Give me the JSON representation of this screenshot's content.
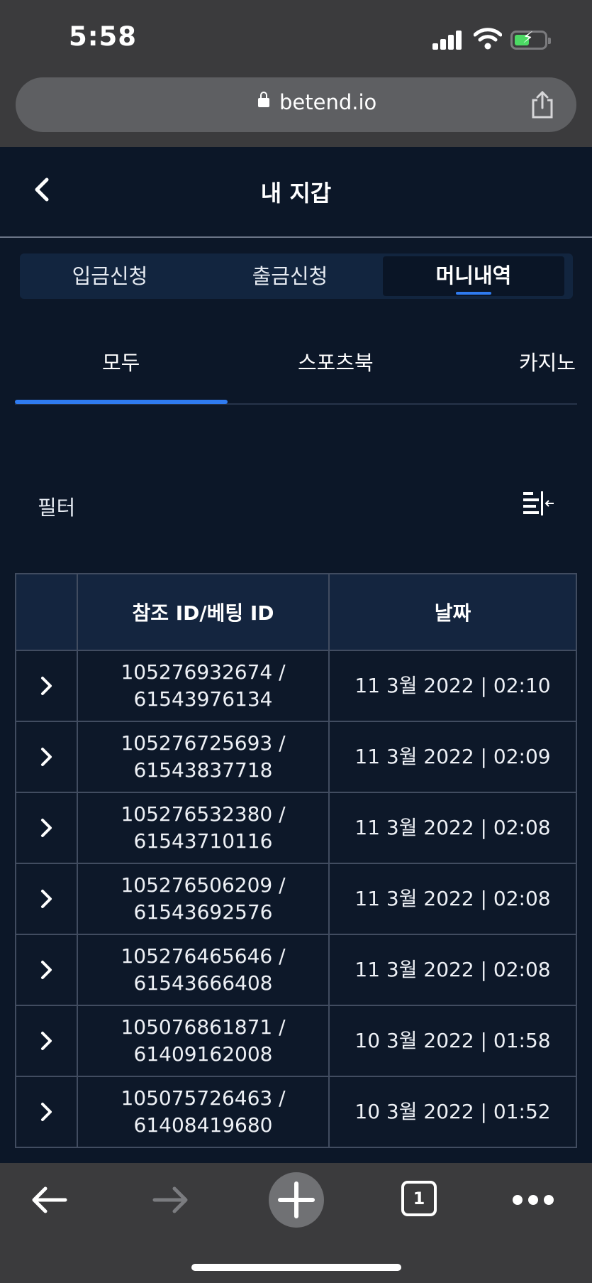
{
  "status_bar": {
    "time": "5:58"
  },
  "browser": {
    "url": "betend.io",
    "tab_count": "1"
  },
  "header": {
    "title": "내 지갑"
  },
  "segmented_tabs": [
    {
      "label": "입금신청",
      "active": false
    },
    {
      "label": "출금신청",
      "active": false
    },
    {
      "label": "머니내역",
      "active": true
    }
  ],
  "category_tabs": [
    {
      "label": "모두",
      "active": true
    },
    {
      "label": "스포츠북",
      "active": false
    },
    {
      "label": "카지노",
      "active": false
    }
  ],
  "filter": {
    "label": "필터"
  },
  "table": {
    "columns": [
      "",
      "참조 ID/베팅 ID",
      "날짜"
    ],
    "rows": [
      {
        "id_line1": "105276932674 /",
        "id_line2": "61543976134",
        "date": "11 3월 2022 | 02:10"
      },
      {
        "id_line1": "105276725693 /",
        "id_line2": "61543837718",
        "date": "11 3월 2022 | 02:09"
      },
      {
        "id_line1": "105276532380 /",
        "id_line2": "61543710116",
        "date": "11 3월 2022 | 02:08"
      },
      {
        "id_line1": "105276506209 /",
        "id_line2": "61543692576",
        "date": "11 3월 2022 | 02:08"
      },
      {
        "id_line1": "105276465646 /",
        "id_line2": "61543666408",
        "date": "11 3월 2022 | 02:08"
      },
      {
        "id_line1": "105076861871 /",
        "id_line2": "61409162008",
        "date": "10 3월 2022 | 01:58"
      },
      {
        "id_line1": "105075726463 /",
        "id_line2": "61408419680",
        "date": "10 3월 2022 | 01:52"
      }
    ]
  },
  "colors": {
    "accent": "#2f7bf0",
    "background": "#0c1728",
    "header_row": "#14253f"
  }
}
